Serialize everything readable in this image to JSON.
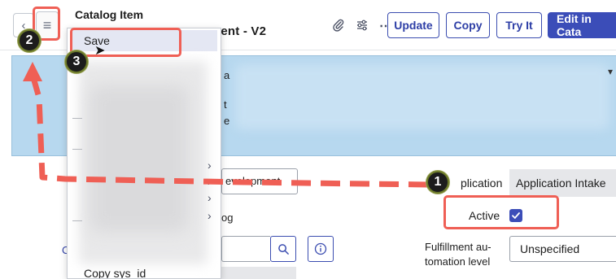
{
  "header": {
    "back_icon": "chevron-left-icon",
    "menu_icon": "hamburger-menu-icon",
    "record_type": "Catalog Item",
    "record_name_fragment": "nent - V2",
    "icons": [
      "paperclip-icon",
      "sliders-icon",
      "more-horizontal-icon"
    ],
    "buttons": {
      "update": "Update",
      "copy": "Copy",
      "try_it": "Try It",
      "edit_in_catalog": "Edit in Cata"
    }
  },
  "banner": {
    "color": "#b7d8ef",
    "fragments": [
      "a",
      "t",
      "e"
    ]
  },
  "context_menu": {
    "save": "Save",
    "copy_sys_id": "Copy sys_id"
  },
  "form": {
    "field_fragment": "evelopment",
    "text_fragment": "og",
    "application_label": "plication",
    "application_value": "Application Intake",
    "active_label": "Active",
    "active_checked": true,
    "fulfillment_label_line1": "Fulfillment au-",
    "fulfillment_label_line2": "tomation level",
    "fulfillment_value": "Unspecified",
    "link_fragment": "C"
  },
  "annotations": {
    "badge_1": "1",
    "badge_2": "2",
    "badge_3": "3",
    "highlight_color": "#ef5f55"
  }
}
